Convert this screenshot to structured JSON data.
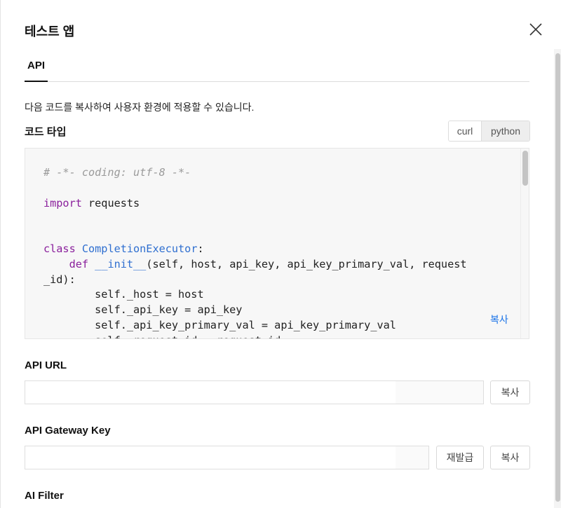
{
  "dialog": {
    "title": "테스트 앱",
    "close_icon": "close-icon"
  },
  "tabs": [
    {
      "label": "API",
      "active": true
    }
  ],
  "description": "다음 코드를 복사하여 사용자 환경에 적용할 수 있습니다.",
  "code_type": {
    "label": "코드 타입",
    "options": [
      "curl",
      "python"
    ],
    "selected": "python"
  },
  "code": {
    "lines": [
      "# -*- coding: utf-8 -*-",
      "",
      "import requests",
      "",
      "",
      "class CompletionExecutor:",
      "    def __init__(self, host, api_key, api_key_primary_val, request",
      "_id):",
      "        self._host = host",
      "        self._api_key = api_key",
      "        self._api_key_primary_val = api_key_primary_val",
      "        self._request_id = request_id"
    ],
    "copy_label": "복사"
  },
  "api_url": {
    "label": "API URL",
    "value": "",
    "copy_label": "복사"
  },
  "api_gateway_key": {
    "label": "API Gateway Key",
    "value": "",
    "reissue_label": "재발급",
    "copy_label": "복사"
  },
  "ai_filter": {
    "label": "AI Filter"
  },
  "colors": {
    "keyword": "#8a1f9c",
    "function": "#2f6fd0",
    "comment": "#9a9a9a",
    "link": "#1a73e8"
  }
}
